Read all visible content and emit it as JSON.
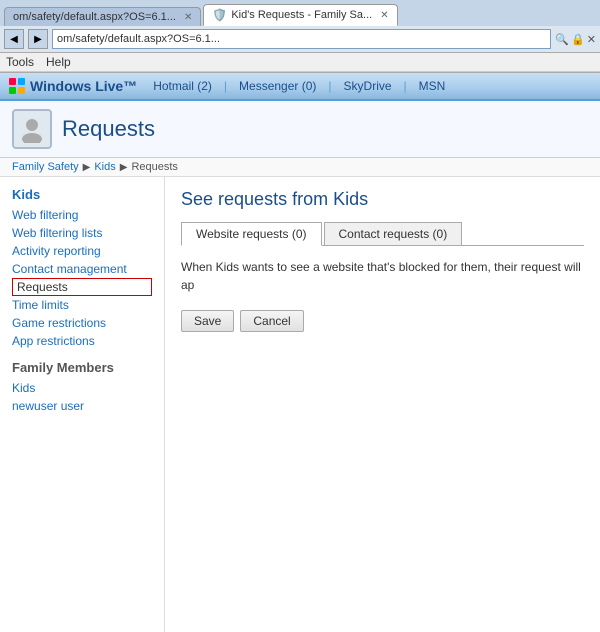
{
  "browser": {
    "tab_inactive_label": "om/safety/default.aspx?OS=6.1...",
    "tab_active_label": "Kid's Requests - Family Sa...",
    "address_bar_text": "om/safety/default.aspx?OS=6.1...",
    "menu_items": [
      "Tools",
      "Help"
    ]
  },
  "wl_header": {
    "logo_text": "Windows Live™",
    "nav_links": [
      {
        "label": "Hotmail",
        "badge": "(2)"
      },
      {
        "label": "Messenger",
        "badge": "(0)"
      },
      {
        "label": "SkyDrive",
        "badge": ""
      },
      {
        "label": "MSN",
        "badge": ""
      }
    ]
  },
  "page_header": {
    "title": "Requests"
  },
  "breadcrumb": {
    "items": [
      "Family Safety",
      "Kids",
      "Requests"
    ]
  },
  "sidebar": {
    "section_title": "Kids",
    "items": [
      {
        "label": "Web filtering",
        "active": false
      },
      {
        "label": "Web filtering lists",
        "active": false
      },
      {
        "label": "Activity reporting",
        "active": false
      },
      {
        "label": "Contact management",
        "active": false
      },
      {
        "label": "Requests",
        "active": true
      },
      {
        "label": "Time limits",
        "active": false
      },
      {
        "label": "Game restrictions",
        "active": false
      },
      {
        "label": "App restrictions",
        "active": false
      }
    ],
    "family_section_title": "Family Members",
    "family_items": [
      {
        "label": "Kids"
      },
      {
        "label": "newuser user"
      }
    ]
  },
  "content": {
    "title": "See requests from Kids",
    "tabs": [
      {
        "label": "Website requests (0)",
        "active": true
      },
      {
        "label": "Contact requests (0)",
        "active": false
      }
    ],
    "description": "When Kids wants to see a website that's blocked for them, their request will ap",
    "save_button": "Save",
    "cancel_button": "Cancel"
  }
}
